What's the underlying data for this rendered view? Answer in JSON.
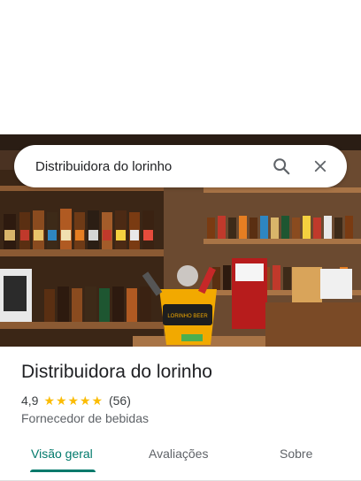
{
  "search": {
    "query": "Distribuidora do lorinho",
    "search_icon": "search-icon",
    "close_icon": "close-icon"
  },
  "hero": {
    "image_icon": "place-photo",
    "bucket_label": "LORINHO BEER"
  },
  "place": {
    "name": "Distribuidora do lorinho",
    "rating": "4,9",
    "stars": 5,
    "review_count": "(56)",
    "category": "Fornecedor de bebidas"
  },
  "tabs": [
    {
      "label": "Visão geral",
      "active": true
    },
    {
      "label": "Avaliações",
      "active": false
    },
    {
      "label": "Sobre",
      "active": false
    }
  ],
  "colors": {
    "accent": "#00796b",
    "star": "#fbbc04",
    "text_primary": "#202124",
    "text_secondary": "#5f6368"
  }
}
